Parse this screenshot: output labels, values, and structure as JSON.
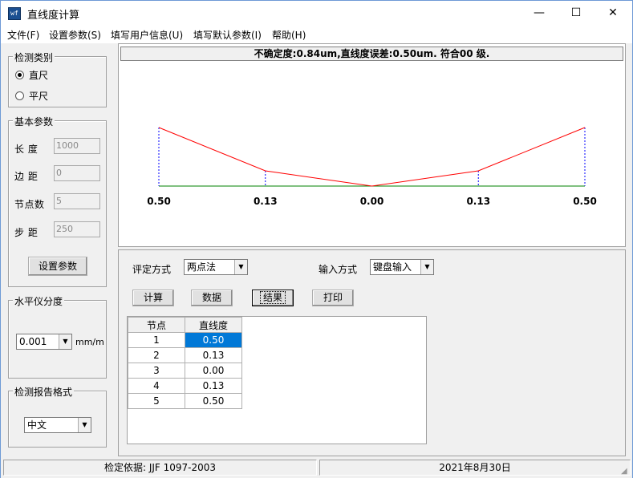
{
  "window": {
    "title": "直线度计算",
    "icon": "app-icon",
    "icon_text": "wf",
    "controls": {
      "minimize": "—",
      "maximize": "☐",
      "close": "✕"
    }
  },
  "menu": [
    {
      "label": "文件(F)"
    },
    {
      "label": "设置参数(S)"
    },
    {
      "label": "填写用户信息(U)"
    },
    {
      "label": "填写默认参数(I)"
    },
    {
      "label": "帮助(H)"
    }
  ],
  "detect_type": {
    "title": "检测类别",
    "options": [
      "直尺",
      "平尺"
    ],
    "selected": "直尺"
  },
  "basic_params": {
    "title": "基本参数",
    "fields": [
      {
        "label": "长  度",
        "value": "1000"
      },
      {
        "label": "边  距",
        "value": "0"
      },
      {
        "label": "节点数",
        "value": "5"
      },
      {
        "label": "步  距",
        "value": "250"
      }
    ],
    "button": "设置参数"
  },
  "level": {
    "title": "水平仪分度",
    "value": "0.001",
    "unit": "mm/m"
  },
  "report": {
    "title": "检测报告格式",
    "value": "中文"
  },
  "result_text": "不确定度:0.84um,直线度误差:0.50um. 符合00 级.",
  "chart_data": {
    "type": "line",
    "x": [
      1,
      2,
      3,
      4,
      5
    ],
    "values": [
      0.5,
      0.13,
      0.0,
      0.13,
      0.5
    ],
    "labels": [
      "0.50",
      "0.13",
      "0.00",
      "0.13",
      "0.50"
    ],
    "series_color": "#ff0000",
    "baseline_color": "#008000",
    "marker_color": "#0000ff"
  },
  "controls": {
    "eval_label": "评定方式",
    "eval_value": "两点法",
    "input_label": "输入方式",
    "input_value": "键盘输入",
    "buttons": [
      "计算",
      "数据",
      "结果",
      "打印"
    ]
  },
  "table": {
    "headers": [
      "节点",
      "直线度"
    ],
    "rows": [
      [
        "1",
        "0.50"
      ],
      [
        "2",
        "0.13"
      ],
      [
        "3",
        "0.00"
      ],
      [
        "4",
        "0.13"
      ],
      [
        "5",
        "0.50"
      ]
    ]
  },
  "status": {
    "basis": "检定依据: JJF 1097-2003",
    "date": "2021年8月30日"
  },
  "colors": {
    "accent": "#0078d7",
    "title_border": "#6e9ad6"
  }
}
